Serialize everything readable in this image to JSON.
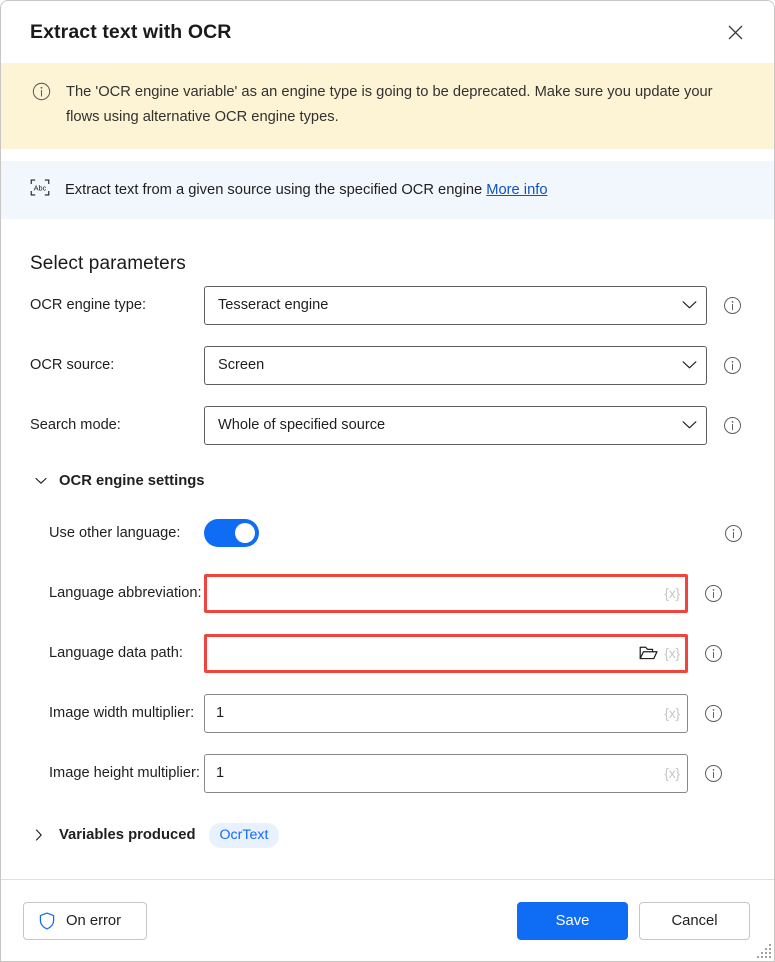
{
  "dialog": {
    "title": "Extract text with OCR",
    "close_icon": "close-icon"
  },
  "warning_banner": {
    "icon": "info-circle-icon",
    "text": "The 'OCR engine variable' as an engine type is going to be deprecated.  Make sure you update your flows using alternative OCR engine types."
  },
  "description_strip": {
    "icon": "abc-text-recognition-icon",
    "text": "Extract text from a given source using the specified OCR engine",
    "link_label": "More info"
  },
  "parameters": {
    "section_title": "Select parameters",
    "fields": [
      {
        "label": "OCR engine type:",
        "type": "combobox",
        "value": "Tesseract engine",
        "info_icon": "info-icon"
      },
      {
        "label": "OCR source:",
        "type": "combobox",
        "value": "Screen",
        "info_icon": "info-icon"
      },
      {
        "label": "Search mode:",
        "type": "combobox",
        "value": "Whole of specified source",
        "info_icon": "info-icon"
      }
    ]
  },
  "engine_settings": {
    "caret": "chevron-down-icon",
    "title": "OCR engine settings",
    "use_other_language": {
      "label": "Use other language:",
      "toggle_on": true,
      "info_icon": "info-icon"
    },
    "fields": [
      {
        "label": "Language abbreviation:",
        "value": "",
        "placeholder": "",
        "variable_badge": "{x}",
        "error": true,
        "has_folder_picker": false,
        "info_icon": "info-icon"
      },
      {
        "label": "Language data path:",
        "value": "",
        "placeholder": "",
        "variable_badge": "{x}",
        "error": true,
        "has_folder_picker": true,
        "folder_icon": "folder-open-icon",
        "info_icon": "info-icon"
      },
      {
        "label": "Image width multiplier:",
        "value": "1",
        "placeholder": "",
        "variable_badge": "{x}",
        "error": false,
        "has_folder_picker": false,
        "info_icon": "info-icon"
      },
      {
        "label": "Image height multiplier:",
        "value": "1",
        "placeholder": "",
        "variable_badge": "{x}",
        "error": false,
        "has_folder_picker": false,
        "info_icon": "info-icon"
      }
    ]
  },
  "variables_produced": {
    "caret": "chevron-right-icon",
    "title": "Variables produced",
    "pill": "OcrText"
  },
  "footer": {
    "on_error_label": "On error",
    "on_error_icon": "shield-icon",
    "save_label": "Save",
    "cancel_label": "Cancel"
  },
  "colors": {
    "accent": "#0f6cf5",
    "warning_bg": "#fdf3d5",
    "info_bg": "#f2f6fd",
    "error_border": "#f0453f",
    "link": "#0f53c2",
    "pill_bg": "#e9f0fe"
  }
}
